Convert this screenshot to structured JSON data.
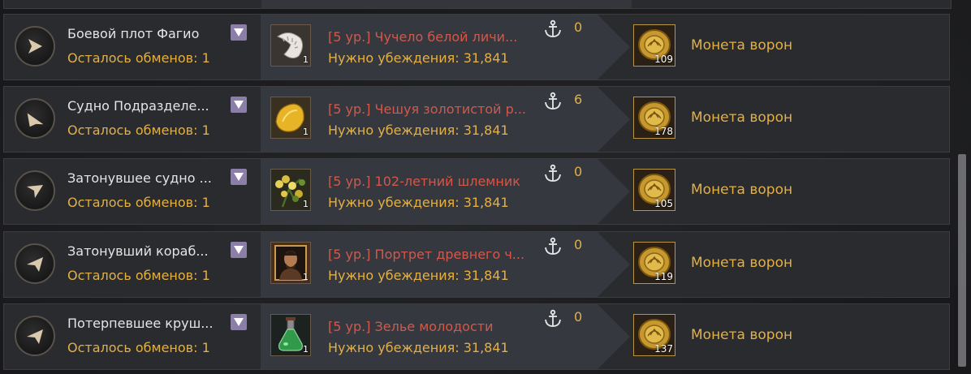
{
  "colors": {
    "accent_gold": "#e3b045",
    "item_red": "#d2584a",
    "row_bg": "#2a2b2e",
    "panel_bg": "#363840",
    "dropdown_purple": "#8b7fa8"
  },
  "rows": [
    {
      "ship": "Боевой плот Фагио",
      "exchanges": "Осталось обменов: 1",
      "direction": "east",
      "item": {
        "name": "[5 ур.] Чучело белой личи...",
        "qty": "1",
        "icon": "larva-icon"
      },
      "persuasion": "Нужно убеждения: 31,841",
      "anchor_count": "0",
      "reward": {
        "name": "Монета ворон",
        "qty": "109",
        "icon": "crow-coin-icon"
      }
    },
    {
      "ship": "Судно Подразделе...",
      "exchanges": "Осталось обменов: 1",
      "direction": "south-east",
      "item": {
        "name": "[5 ур.] Чешуя золотистой р...",
        "qty": "1",
        "icon": "gold-scale-icon"
      },
      "persuasion": "Нужно убеждения: 31,841",
      "anchor_count": "6",
      "reward": {
        "name": "Монета ворон",
        "qty": "178",
        "icon": "crow-coin-icon"
      }
    },
    {
      "ship": "Затонувшее судно ...",
      "exchanges": "Осталось обменов: 1",
      "direction": "south-west",
      "item": {
        "name": "[5 ур.] 102-летний шлемник",
        "qty": "1",
        "icon": "herb-icon"
      },
      "persuasion": "Нужно убеждения: 31,841",
      "anchor_count": "0",
      "reward": {
        "name": "Монета ворон",
        "qty": "105",
        "icon": "crow-coin-icon"
      }
    },
    {
      "ship": "Затонувший кораб...",
      "exchanges": "Осталось обменов: 1",
      "direction": "west",
      "item": {
        "name": "[5 ур.] Портрет древнего ч...",
        "qty": "1",
        "icon": "portrait-icon"
      },
      "persuasion": "Нужно убеждения: 31,841",
      "anchor_count": "0",
      "reward": {
        "name": "Монета ворон",
        "qty": "119",
        "icon": "crow-coin-icon"
      }
    },
    {
      "ship": "Потерпевшее круш...",
      "exchanges": "Осталось обменов: 1",
      "direction": "west",
      "item": {
        "name": "[5 ур.] Зелье молодости",
        "qty": "1",
        "icon": "potion-icon"
      },
      "persuasion": "Нужно убеждения: 31,841",
      "anchor_count": "0",
      "reward": {
        "name": "Монета ворон",
        "qty": "137",
        "icon": "crow-coin-icon"
      }
    }
  ]
}
